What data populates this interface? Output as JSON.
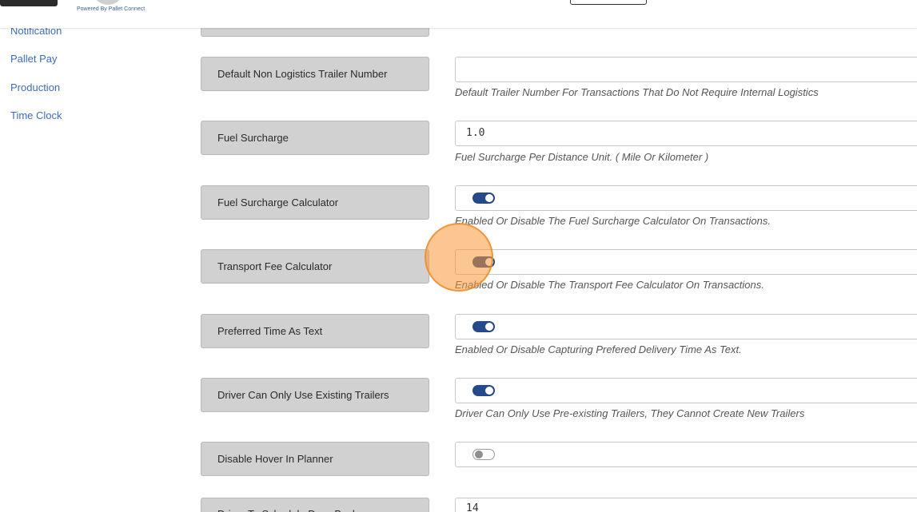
{
  "header": {
    "powered_by": "Powered By Pallet Connect"
  },
  "sidebar": {
    "items": [
      {
        "label": "Notification"
      },
      {
        "label": "Pallet Pay"
      },
      {
        "label": "Production"
      },
      {
        "label": "Time Clock"
      }
    ]
  },
  "settings": [
    {
      "label": "Default Non Logistics Trailer Number",
      "type": "text",
      "value": "",
      "hint": "Default Trailer Number For Transactions That Do Not Require Internal Logistics"
    },
    {
      "label": "Fuel Surcharge",
      "type": "text",
      "value": "1.0",
      "hint": "Fuel Surcharge Per Distance Unit. ( Mile Or Kilometer )"
    },
    {
      "label": "Fuel Surcharge Calculator",
      "type": "toggle",
      "state": "on",
      "hint": "Enabled Or Disable The Fuel Surcharge Calculator On Transactions."
    },
    {
      "label": "Transport Fee Calculator",
      "type": "toggle",
      "state": "on",
      "hint": "Enabled Or Disable The Transport Fee Calculator On Transactions."
    },
    {
      "label": "Preferred Time As Text",
      "type": "toggle",
      "state": "on",
      "hint": "Enabled Or Disable Capturing Prefered Delivery Time As Text."
    },
    {
      "label": "Driver Can Only Use Existing Trailers",
      "type": "toggle",
      "state": "on",
      "hint": "Driver Can Only Use Pre-existing Trailers, They Cannot Create New Trailers"
    },
    {
      "label": "Disable Hover In Planner",
      "type": "toggle",
      "state": "off",
      "hint": ""
    },
    {
      "label": "Driver To Schedule Days Back",
      "type": "text",
      "value": "14",
      "hint": ""
    }
  ],
  "colors": {
    "link": "#3c6bbd",
    "toggle_on": "#244a8a",
    "label_bg": "#d1d1d1",
    "cursor_highlight": "#f79839"
  }
}
